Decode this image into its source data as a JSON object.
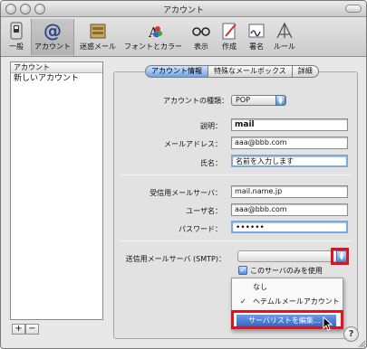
{
  "window": {
    "title": "アカウント"
  },
  "toolbar": {
    "items": [
      {
        "label": "一般",
        "icon": "switch-icon"
      },
      {
        "label": "アカウント",
        "icon": "at-sign-icon"
      },
      {
        "label": "迷惑メール",
        "icon": "junk-mail-icon"
      },
      {
        "label": "フォントとカラー",
        "icon": "font-color-icon"
      },
      {
        "label": "表示",
        "icon": "glasses-icon"
      },
      {
        "label": "作成",
        "icon": "compose-icon"
      },
      {
        "label": "署名",
        "icon": "signature-icon"
      },
      {
        "label": "ルール",
        "icon": "rules-icon"
      }
    ],
    "selected": "アカウント"
  },
  "accounts_list": {
    "header": "アカウント",
    "items": [
      "新しいアカウント"
    ],
    "add_label": "+",
    "remove_label": "−"
  },
  "tabs": [
    {
      "label": "アカウント情報",
      "active": true
    },
    {
      "label": "特殊なメールボックス",
      "active": false
    },
    {
      "label": "詳細",
      "active": false
    }
  ],
  "form": {
    "account_type_label": "アカウントの種類：",
    "account_type_value": "POP",
    "description_label": "説明：",
    "description_value": "mail",
    "email_label": "メールアドレス：",
    "email_value": "aaa@bbb.com",
    "name_label": "氏名：",
    "name_value": "名前を入力します",
    "incoming_label": "受信用メールサーバ：",
    "incoming_value": "mail.name.jp",
    "user_label": "ユーザ名：",
    "user_value": "aaa@bbb.com",
    "password_label": "パスワード：",
    "password_value": "••••••",
    "smtp_label": "送信用メールサーバ (SMTP)：",
    "smtp_value": "",
    "only_this_server_label": "このサーバのみを使用",
    "only_this_server_checked": true
  },
  "smtp_menu": {
    "items": [
      {
        "label": "なし",
        "checked": false
      },
      {
        "label": "ヘテムルメールアカウント",
        "checked": true
      }
    ],
    "check_mark": "✓",
    "edit_list_label": "サーバリストを編集..."
  },
  "help_label": "?",
  "colors": {
    "highlight": "#e0141c",
    "selection_blue": "#2e63c7"
  }
}
